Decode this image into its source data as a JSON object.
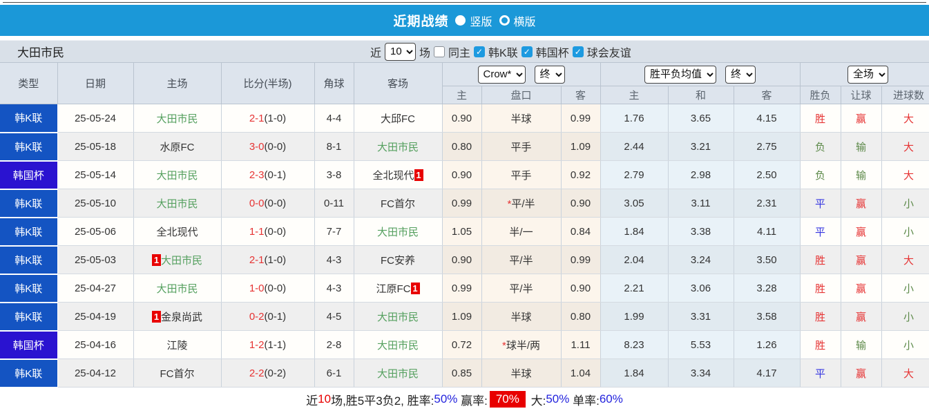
{
  "colors": {
    "accent": "#1b98d8",
    "league-k": "#1454c2",
    "league-cup": "#2a13d0",
    "self-team": "#55a05f",
    "win": "#e63333",
    "draw": "#3535e0",
    "lose": "#5d8a4a",
    "badge": "#e80000"
  },
  "titlebar": {
    "title": "近期战绩",
    "vertical_label": "竖版",
    "horizontal_label": "横版"
  },
  "filterbar": {
    "team": "大田市民",
    "near_label": "近",
    "count_option": "10",
    "matches_label": "场",
    "same_home_label": "同主",
    "leagues": [
      "韩K联",
      "韩国杯",
      "球会友谊"
    ]
  },
  "table": {
    "columns": {
      "type": "类型",
      "date": "日期",
      "home": "主场",
      "score": "比分(半场)",
      "corner": "角球",
      "away": "客场"
    },
    "dropdowns": {
      "bookmaker": "Crow*",
      "bookmaker_state": "终",
      "odds_type": "胜平负均值",
      "odds_state": "终",
      "scope": "全场"
    },
    "subheaders": {
      "handicap_home": "主",
      "handicap_line": "盘口",
      "handicap_away": "客",
      "odds_home": "主",
      "odds_draw": "和",
      "odds_away": "客",
      "result_wl": "胜负",
      "result_handicap": "让球",
      "result_goals": "进球数"
    },
    "rows": [
      {
        "league": "韩K联",
        "league_class": "lg-k",
        "date": "25-05-24",
        "home_badge_before": "",
        "home": "大田市民",
        "home_self": true,
        "home_badge_after": "",
        "score": "2-1",
        "half": "(1-0)",
        "corners": "4-4",
        "away_badge_before": "",
        "away": "大邱FC",
        "away_self": false,
        "away_badge_after": "",
        "handicap_home": "0.90",
        "handicap_star": "",
        "handicap_line": "半球",
        "handicap_away": "0.99",
        "odds_home": "1.76",
        "odds_draw": "3.65",
        "odds_away": "4.15",
        "wl": "胜",
        "wl_class": "r-win",
        "rh": "赢",
        "rh_class": "r-win",
        "goals": "大",
        "goals_class": "r-big"
      },
      {
        "league": "韩K联",
        "league_class": "lg-k",
        "date": "25-05-18",
        "home_badge_before": "",
        "home": "水原FC",
        "home_self": false,
        "home_badge_after": "",
        "score": "3-0",
        "half": "(0-0)",
        "corners": "8-1",
        "away_badge_before": "",
        "away": "大田市民",
        "away_self": true,
        "away_badge_after": "",
        "handicap_home": "0.80",
        "handicap_star": "",
        "handicap_line": "平手",
        "handicap_away": "1.09",
        "odds_home": "2.44",
        "odds_draw": "3.21",
        "odds_away": "2.75",
        "wl": "负",
        "wl_class": "r-lose",
        "rh": "输",
        "rh_class": "r-lose",
        "goals": "大",
        "goals_class": "r-big"
      },
      {
        "league": "韩国杯",
        "league_class": "lg-cup",
        "date": "25-05-14",
        "home_badge_before": "",
        "home": "大田市民",
        "home_self": true,
        "home_badge_after": "",
        "score": "2-3",
        "half": "(0-1)",
        "corners": "3-8",
        "away_badge_before": "",
        "away": "全北现代",
        "away_self": false,
        "away_badge_after": "1",
        "handicap_home": "0.90",
        "handicap_star": "",
        "handicap_line": "平手",
        "handicap_away": "0.92",
        "odds_home": "2.79",
        "odds_draw": "2.98",
        "odds_away": "2.50",
        "wl": "负",
        "wl_class": "r-lose",
        "rh": "输",
        "rh_class": "r-lose",
        "goals": "大",
        "goals_class": "r-big"
      },
      {
        "league": "韩K联",
        "league_class": "lg-k",
        "date": "25-05-10",
        "home_badge_before": "",
        "home": "大田市民",
        "home_self": true,
        "home_badge_after": "",
        "score": "0-0",
        "half": "(0-0)",
        "corners": "0-11",
        "away_badge_before": "",
        "away": "FC首尔",
        "away_self": false,
        "away_badge_after": "",
        "handicap_home": "0.99",
        "handicap_star": "*",
        "handicap_line": "平/半",
        "handicap_away": "0.90",
        "odds_home": "3.05",
        "odds_draw": "3.11",
        "odds_away": "2.31",
        "wl": "平",
        "wl_class": "r-draw",
        "rh": "赢",
        "rh_class": "r-win",
        "goals": "小",
        "goals_class": "r-small"
      },
      {
        "league": "韩K联",
        "league_class": "lg-k",
        "date": "25-05-06",
        "home_badge_before": "",
        "home": "全北现代",
        "home_self": false,
        "home_badge_after": "",
        "score": "1-1",
        "half": "(0-0)",
        "corners": "7-7",
        "away_badge_before": "",
        "away": "大田市民",
        "away_self": true,
        "away_badge_after": "",
        "handicap_home": "1.05",
        "handicap_star": "",
        "handicap_line": "半/一",
        "handicap_away": "0.84",
        "odds_home": "1.84",
        "odds_draw": "3.38",
        "odds_away": "4.11",
        "wl": "平",
        "wl_class": "r-draw",
        "rh": "赢",
        "rh_class": "r-win",
        "goals": "小",
        "goals_class": "r-small"
      },
      {
        "league": "韩K联",
        "league_class": "lg-k",
        "date": "25-05-03",
        "home_badge_before": "1",
        "home": "大田市民",
        "home_self": true,
        "home_badge_after": "",
        "score": "2-1",
        "half": "(1-0)",
        "corners": "4-3",
        "away_badge_before": "",
        "away": "FC安养",
        "away_self": false,
        "away_badge_after": "",
        "handicap_home": "0.90",
        "handicap_star": "",
        "handicap_line": "平/半",
        "handicap_away": "0.99",
        "odds_home": "2.04",
        "odds_draw": "3.24",
        "odds_away": "3.50",
        "wl": "胜",
        "wl_class": "r-win",
        "rh": "赢",
        "rh_class": "r-win",
        "goals": "大",
        "goals_class": "r-big"
      },
      {
        "league": "韩K联",
        "league_class": "lg-k",
        "date": "25-04-27",
        "home_badge_before": "",
        "home": "大田市民",
        "home_self": true,
        "home_badge_after": "",
        "score": "1-0",
        "half": "(0-0)",
        "corners": "4-3",
        "away_badge_before": "",
        "away": "江原FC",
        "away_self": false,
        "away_badge_after": "1",
        "handicap_home": "0.99",
        "handicap_star": "",
        "handicap_line": "平/半",
        "handicap_away": "0.90",
        "odds_home": "2.21",
        "odds_draw": "3.06",
        "odds_away": "3.28",
        "wl": "胜",
        "wl_class": "r-win",
        "rh": "赢",
        "rh_class": "r-win",
        "goals": "小",
        "goals_class": "r-small"
      },
      {
        "league": "韩K联",
        "league_class": "lg-k",
        "date": "25-04-19",
        "home_badge_before": "1",
        "home": "金泉尚武",
        "home_self": false,
        "home_badge_after": "",
        "score": "0-2",
        "half": "(0-1)",
        "corners": "4-5",
        "away_badge_before": "",
        "away": "大田市民",
        "away_self": true,
        "away_badge_after": "",
        "handicap_home": "1.09",
        "handicap_star": "",
        "handicap_line": "半球",
        "handicap_away": "0.80",
        "odds_home": "1.99",
        "odds_draw": "3.31",
        "odds_away": "3.58",
        "wl": "胜",
        "wl_class": "r-win",
        "rh": "赢",
        "rh_class": "r-win",
        "goals": "小",
        "goals_class": "r-small"
      },
      {
        "league": "韩国杯",
        "league_class": "lg-cup",
        "date": "25-04-16",
        "home_badge_before": "",
        "home": "江陵",
        "home_self": false,
        "home_badge_after": "",
        "score": "1-2",
        "half": "(1-1)",
        "corners": "2-8",
        "away_badge_before": "",
        "away": "大田市民",
        "away_self": true,
        "away_badge_after": "",
        "handicap_home": "0.72",
        "handicap_star": "*",
        "handicap_line": "球半/两",
        "handicap_away": "1.11",
        "odds_home": "8.23",
        "odds_draw": "5.53",
        "odds_away": "1.26",
        "wl": "胜",
        "wl_class": "r-win",
        "rh": "输",
        "rh_class": "r-lose",
        "goals": "小",
        "goals_class": "r-small"
      },
      {
        "league": "韩K联",
        "league_class": "lg-k",
        "date": "25-04-12",
        "home_badge_before": "",
        "home": "FC首尔",
        "home_self": false,
        "home_badge_after": "",
        "score": "2-2",
        "half": "(0-2)",
        "corners": "6-1",
        "away_badge_before": "",
        "away": "大田市民",
        "away_self": true,
        "away_badge_after": "",
        "handicap_home": "0.85",
        "handicap_star": "",
        "handicap_line": "半球",
        "handicap_away": "1.04",
        "odds_home": "1.84",
        "odds_draw": "3.34",
        "odds_away": "4.17",
        "wl": "平",
        "wl_class": "r-draw",
        "rh": "赢",
        "rh_class": "r-win",
        "goals": "大",
        "goals_class": "r-big"
      }
    ]
  },
  "footer": {
    "near_label": "近",
    "count": "10",
    "summary": "场,胜5平3负2, ",
    "win_rate_label": "胜率:",
    "win_rate": "50%",
    "profit_label": " 赢率:",
    "profit_rate": "70%",
    "big_label": " 大:",
    "big_rate": "50%",
    "single_label": " 单率:",
    "single_rate": "60%"
  }
}
